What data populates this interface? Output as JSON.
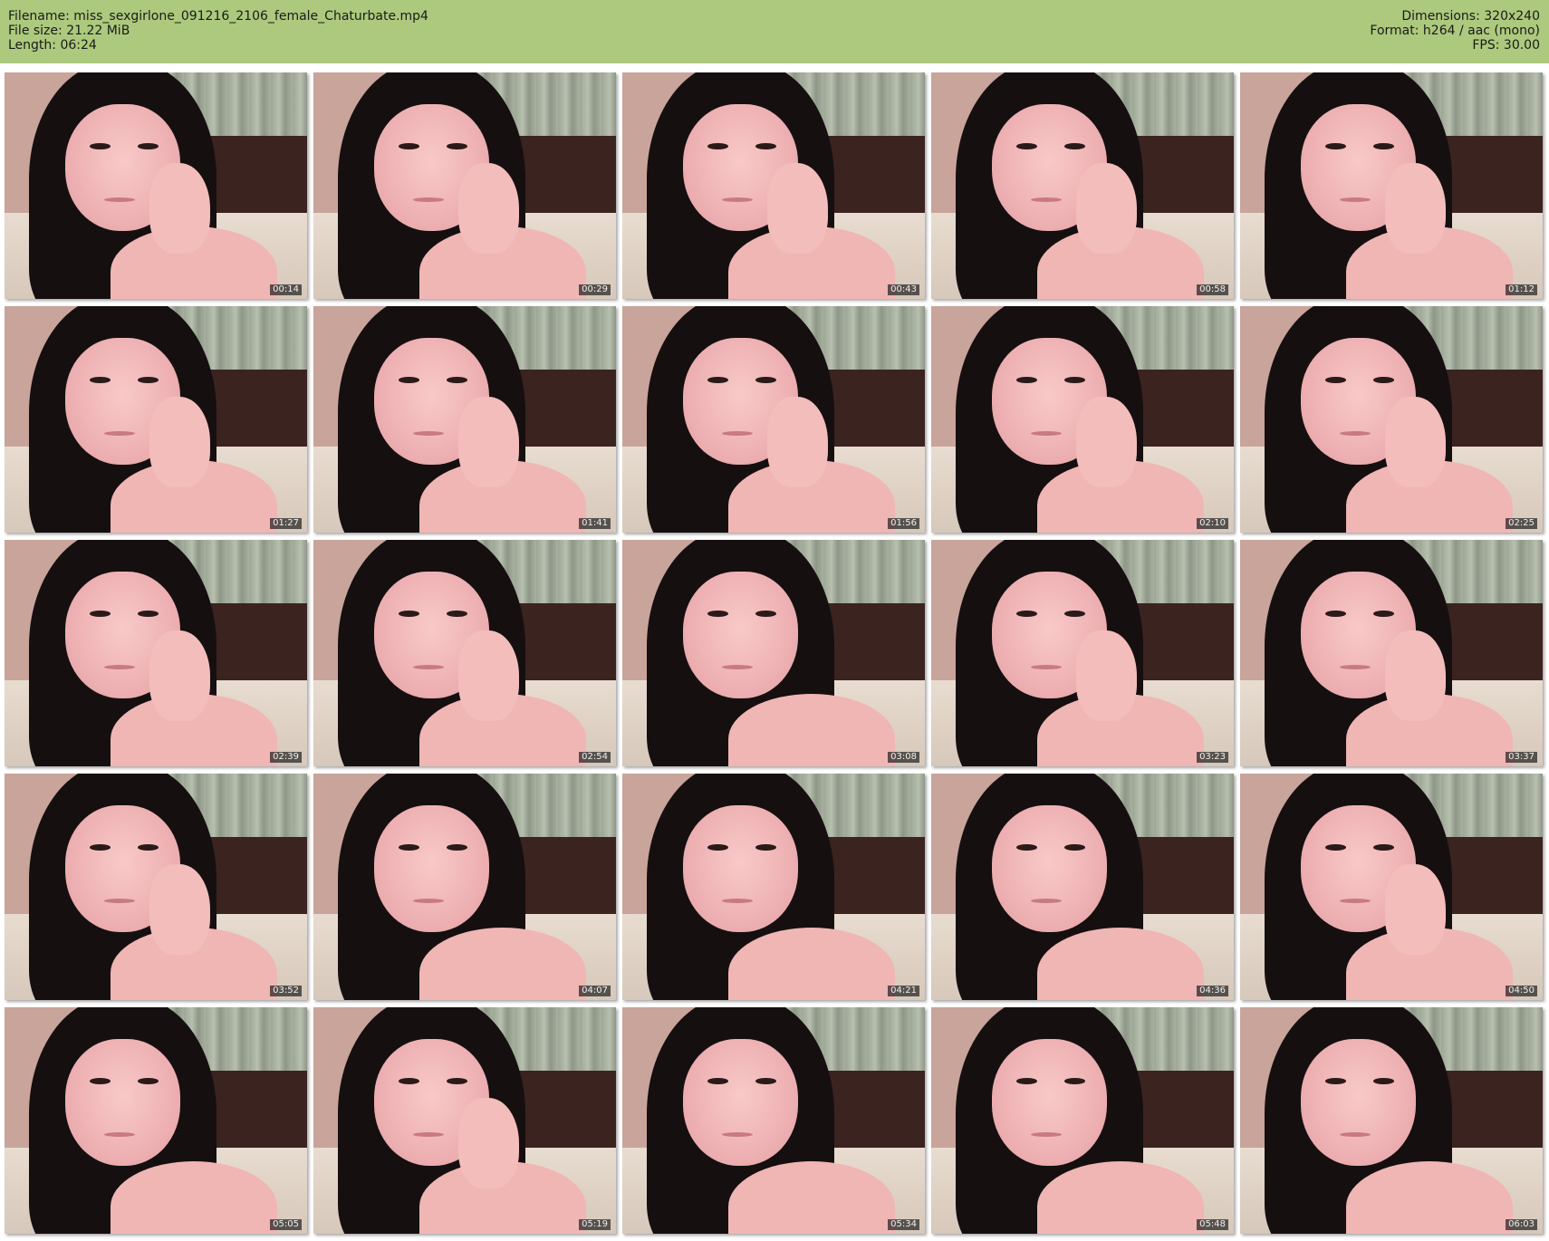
{
  "header": {
    "filename": "Filename: miss_sexgirlone_091216_2106_female_Chaturbate.mp4",
    "filesize": "File size: 21.22 MiB",
    "length": "Length: 06:24",
    "dimensions": "Dimensions: 320x240",
    "format": "Format: h264 / aac (mono)",
    "fps": "FPS: 30.00"
  },
  "thumbnails": [
    {
      "time": "00:14"
    },
    {
      "time": "00:29"
    },
    {
      "time": "00:43"
    },
    {
      "time": "00:58"
    },
    {
      "time": "01:12"
    },
    {
      "time": "01:27"
    },
    {
      "time": "01:41"
    },
    {
      "time": "01:56"
    },
    {
      "time": "02:10"
    },
    {
      "time": "02:25"
    },
    {
      "time": "02:39"
    },
    {
      "time": "02:54"
    },
    {
      "time": "03:08"
    },
    {
      "time": "03:23"
    },
    {
      "time": "03:37"
    },
    {
      "time": "03:52"
    },
    {
      "time": "04:07"
    },
    {
      "time": "04:21"
    },
    {
      "time": "04:36"
    },
    {
      "time": "04:50"
    },
    {
      "time": "05:05"
    },
    {
      "time": "05:19"
    },
    {
      "time": "05:34"
    },
    {
      "time": "05:48"
    },
    {
      "time": "06:03"
    }
  ]
}
